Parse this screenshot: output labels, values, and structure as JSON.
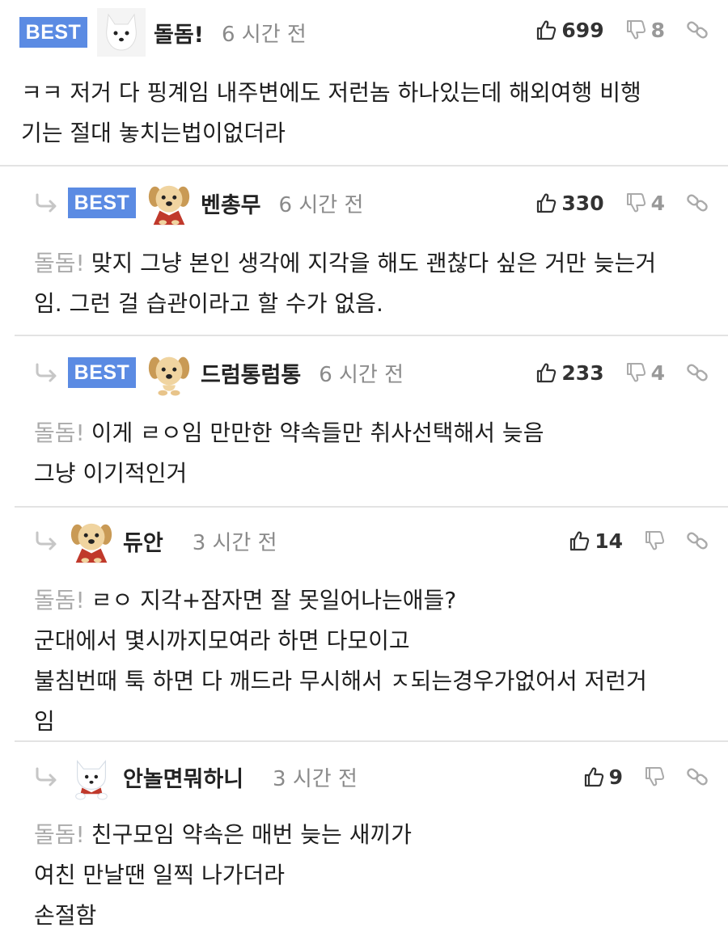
{
  "comments": [
    {
      "best": "BEST",
      "nickname": "돌돔!",
      "time": "6 시간 전",
      "likes": "699",
      "dislikes": "8",
      "avatar": "white-dog-avatar",
      "quote": "",
      "lines": [
        "ㅋㅋ 저거 다 핑계임 내주변에도 저런놈 하나있는데 해외여행 비행",
        "기는 절대 놓치는법이없더라"
      ]
    },
    {
      "best": "BEST",
      "nickname": "벤총무",
      "time": "6 시간 전",
      "likes": "330",
      "dislikes": "4",
      "avatar": "puppy-cape-avatar",
      "quote": "돌돔!",
      "lines": [
        "맞지 그냥 본인 생각에 지각을 해도 괜찮다 싶은 거만 늦는거",
        "임. 그런 걸 습관이라고 할 수가 없음."
      ]
    },
    {
      "best": "BEST",
      "nickname": "드럼통럼통",
      "time": "6 시간 전",
      "likes": "233",
      "dislikes": "4",
      "avatar": "puppy-avatar",
      "quote": "돌돔!",
      "lines": [
        "이게 ㄹㅇ임 만만한 약속들만 취사선택해서 늦음",
        "그냥 이기적인거"
      ]
    },
    {
      "best": "",
      "nickname": "듀안",
      "time": "3 시간 전",
      "likes": "14",
      "dislikes": "",
      "avatar": "puppy-cape-avatar",
      "quote": "돌돔!",
      "lines": [
        "ㄹㅇ 지각+잠자면 잘 못일어나는애들?",
        "군대에서 몇시까지모여라 하면 다모이고",
        "불침번때 툭 하면 다 깨드라 무시해서 ㅈ되는경우가없어서 저런거",
        "임"
      ]
    },
    {
      "best": "",
      "nickname": "안놀면뭐하니",
      "time": "3 시간 전",
      "likes": "9",
      "dislikes": "",
      "avatar": "white-dog-cape-avatar",
      "quote": "돌돔!",
      "lines": [
        "친구모임 약속은 매번 늦는 새끼가",
        "여친 만날땐 일찍 나가더라",
        "손절함"
      ]
    }
  ],
  "icons": {
    "like": "thumbs-up-icon",
    "dislike": "thumbs-down-icon",
    "link": "link-icon",
    "reply": "reply-arrow-icon"
  },
  "colors": {
    "best_badge": "#5b8be3",
    "quote_text": "#aaaaaa",
    "time_text": "#8a8a8a"
  }
}
